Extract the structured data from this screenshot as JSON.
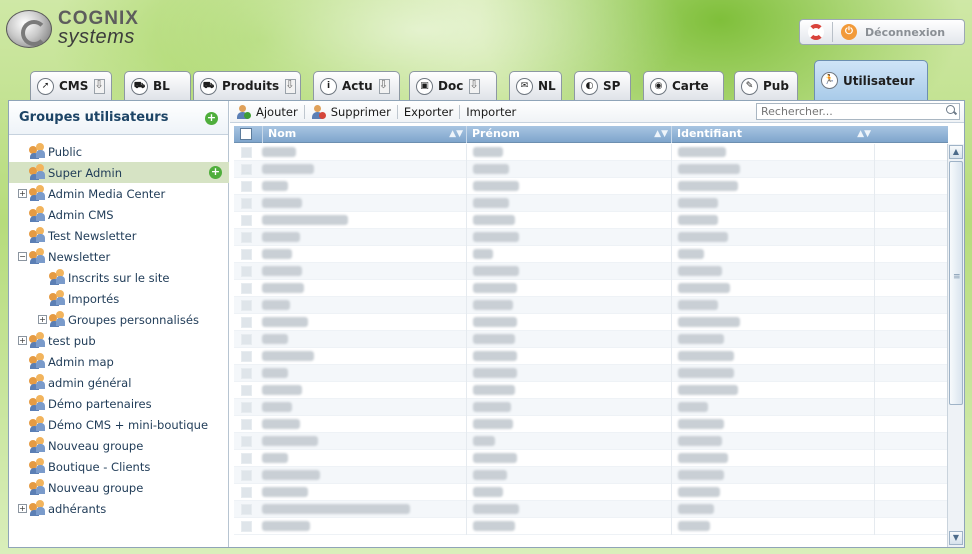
{
  "header": {
    "logo_top": "COGNIX",
    "logo_bottom": "systems",
    "logout_label": "Déconnexion"
  },
  "tabs": [
    {
      "label": "CMS",
      "icon": "compass-icon",
      "dropdown": true
    },
    {
      "label": "BL",
      "icon": "cart-icon",
      "dropdown": false
    },
    {
      "label": "Produits",
      "icon": "cart-icon",
      "dropdown": true
    },
    {
      "label": "Actu",
      "icon": "info-icon",
      "dropdown": true
    },
    {
      "label": "Doc",
      "icon": "camera-icon",
      "dropdown": true
    },
    {
      "label": "NL",
      "icon": "envelope-icon",
      "dropdown": false
    },
    {
      "label": "SP",
      "icon": "disc-icon",
      "dropdown": false
    },
    {
      "label": "Carte",
      "icon": "globe-icon",
      "dropdown": false
    },
    {
      "label": "Pub",
      "icon": "pen-icon",
      "dropdown": false
    },
    {
      "label": "Utilisateur",
      "icon": "runner-icon",
      "dropdown": false,
      "active": true
    }
  ],
  "left": {
    "title": "Groupes utilisateurs",
    "groups": [
      {
        "label": "Public",
        "level": 0,
        "expander": ""
      },
      {
        "label": "Super Admin",
        "level": 0,
        "expander": "",
        "selected": true
      },
      {
        "label": "Admin Media Center",
        "level": 0,
        "expander": "+"
      },
      {
        "label": "Admin CMS",
        "level": 0,
        "expander": ""
      },
      {
        "label": "Test Newsletter",
        "level": 0,
        "expander": ""
      },
      {
        "label": "Newsletter",
        "level": 0,
        "expander": "−"
      },
      {
        "label": "Inscrits sur le site",
        "level": 1,
        "expander": ""
      },
      {
        "label": "Importés",
        "level": 1,
        "expander": ""
      },
      {
        "label": "Groupes personnalisés",
        "level": 1,
        "expander": "+"
      },
      {
        "label": "test pub",
        "level": 0,
        "expander": "+"
      },
      {
        "label": "Admin map",
        "level": 0,
        "expander": ""
      },
      {
        "label": "admin général",
        "level": 0,
        "expander": ""
      },
      {
        "label": "Démo partenaires",
        "level": 0,
        "expander": ""
      },
      {
        "label": "Démo CMS + mini-boutique",
        "level": 0,
        "expander": ""
      },
      {
        "label": "Nouveau groupe",
        "level": 0,
        "expander": ""
      },
      {
        "label": "Boutique - Clients",
        "level": 0,
        "expander": ""
      },
      {
        "label": "Nouveau groupe",
        "level": 0,
        "expander": ""
      },
      {
        "label": "adhérants",
        "level": 0,
        "expander": "+"
      }
    ]
  },
  "toolbar": {
    "add_label": "Ajouter",
    "delete_label": "Supprimer",
    "export_label": "Exporter",
    "import_label": "Importer",
    "search_placeholder": "Rechercher..."
  },
  "grid": {
    "columns": [
      "Nom",
      "Prénom",
      "Identifiant"
    ]
  }
}
